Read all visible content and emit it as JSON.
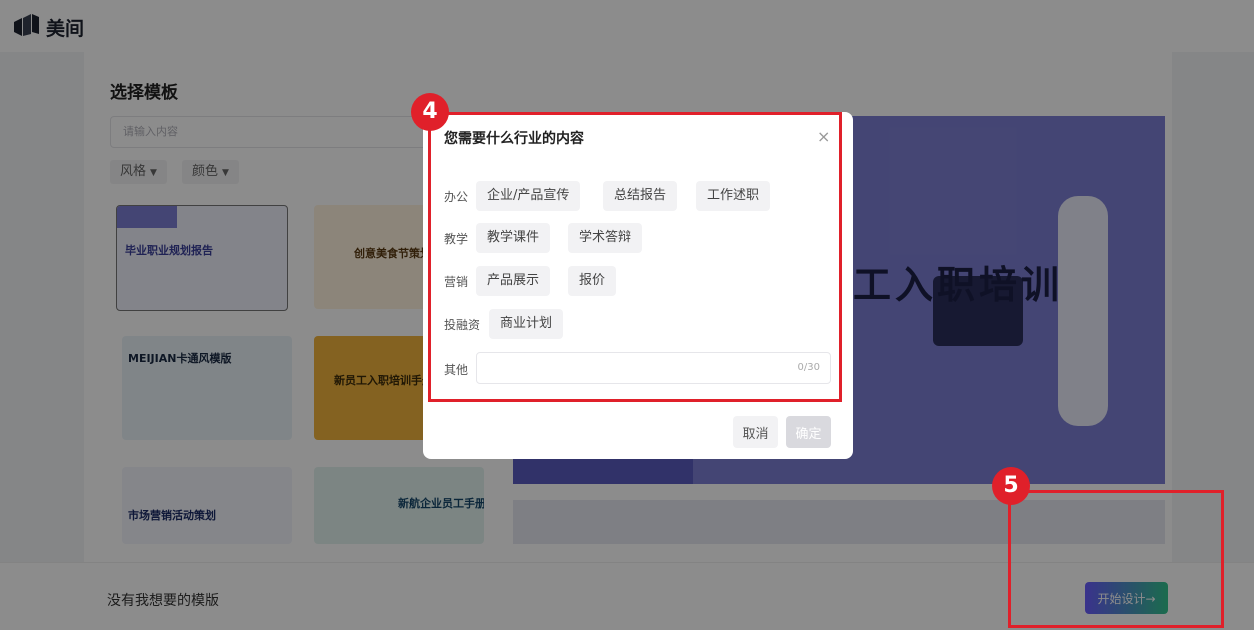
{
  "header": {
    "brand": "美间"
  },
  "page": {
    "title": "选择模板",
    "search_placeholder": "请输入内容",
    "filters": [
      {
        "label": "风格"
      },
      {
        "label": "颜色"
      }
    ],
    "templates": [
      {
        "label": "毕业职业规划报告"
      },
      {
        "label": "创意美食节策划"
      },
      {
        "label": "MEIJIAN卡通风模版"
      },
      {
        "label": "新员工入职培训手册"
      },
      {
        "label": "市场营销活动策划"
      },
      {
        "label": "新航企业员工手册范本"
      }
    ],
    "preview_text": "工入职培训"
  },
  "footer": {
    "text": "没有我想要的模版",
    "start_button": "开始设计→"
  },
  "modal": {
    "title": "您需要什么行业的内容",
    "close": "×",
    "categories": [
      {
        "label": "办公",
        "tags": [
          "企业/产品宣传",
          "总结报告",
          "工作述职"
        ]
      },
      {
        "label": "教学",
        "tags": [
          "教学课件",
          "学术答辩"
        ]
      },
      {
        "label": "营销",
        "tags": [
          "产品展示",
          "报价"
        ]
      },
      {
        "label": "投融资",
        "tags": [
          "商业计划"
        ]
      }
    ],
    "other": {
      "label": "其他",
      "counter": "0/30"
    },
    "cancel": "取消",
    "confirm": "确定"
  },
  "annotations": {
    "step4": "4",
    "step5": "5",
    "color": "#e0202a"
  }
}
